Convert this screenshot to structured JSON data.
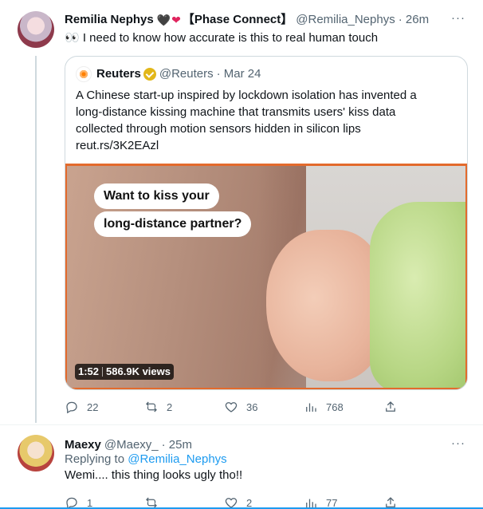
{
  "tweet1": {
    "name": "Remilia Nephys",
    "hearts": [
      "🖤",
      "❤"
    ],
    "name_extra": "【Phase Connect】",
    "handle": "@Remilia_Nephys",
    "time": "· 26m",
    "text": "👀 I need to know how accurate is this to real human touch",
    "more": "···",
    "quote": {
      "name": "Reuters",
      "handle": "@Reuters",
      "time": "· Mar 24",
      "lines": [
        "A Chinese start-up inspired by lockdown isolation has invented a",
        "long-distance kissing machine that transmits users' kiss data",
        "collected through motion sensors hidden in silicon lips",
        "reut.rs/3K2EAzl"
      ],
      "media": {
        "caption_1": "Want to kiss your",
        "caption_2": "long-distance partner?",
        "duration": "1:52",
        "views": "586.9K views"
      }
    },
    "actions": {
      "reply": "22",
      "retweet": "2",
      "like": "36",
      "views": "768"
    }
  },
  "tweet2": {
    "name": "Maexy",
    "handle": "@Maexy_",
    "time": "· 25m",
    "more": "···",
    "replying_prefix": "Replying to",
    "replying_handle": "@Remilia_Nephys",
    "text": "Wemi.... this thing looks ugly tho!!",
    "actions": {
      "reply": "1",
      "retweet": "",
      "like": "2",
      "views": "77"
    }
  },
  "colors": {
    "accent": "#1d9bf0",
    "muted": "#536471",
    "media_border": "#e36a2c",
    "verified_gold": "#e2b719",
    "heart_red": "#e0245e"
  }
}
